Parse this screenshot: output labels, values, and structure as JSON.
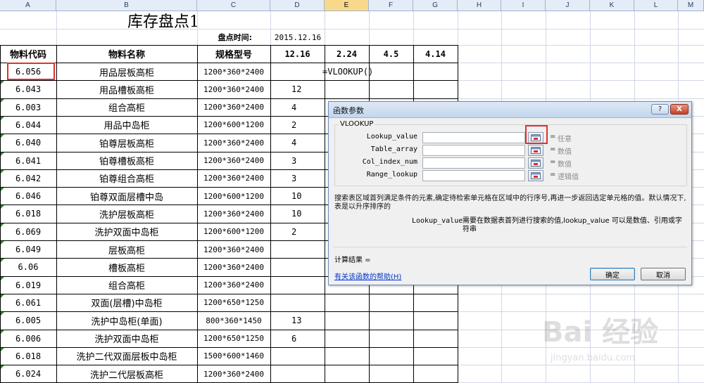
{
  "columns": [
    "A",
    "B",
    "C",
    "D",
    "E",
    "F",
    "G",
    "H",
    "I",
    "J",
    "K",
    "L",
    "M"
  ],
  "sheet": {
    "title": "库存盘点1",
    "check_time_label": "盘点时间:",
    "check_time_value": "2015.12.16",
    "headers": {
      "code": "物料代码",
      "name": "物料名称",
      "spec": "规格型号"
    },
    "dates": [
      "12.16",
      "2.24",
      "4.5",
      "4.14"
    ],
    "formula": "=VLOOKUP()",
    "rows": [
      {
        "code": "6.056",
        "name": "用品层板高柜",
        "spec": "1200*360*2400",
        "qty": ""
      },
      {
        "code": "6.043",
        "name": "用品槽板高柜",
        "spec": "1200*360*2400",
        "qty": "12"
      },
      {
        "code": "6.003",
        "name": "组合高柜",
        "spec": "1200*360*2400",
        "qty": "4"
      },
      {
        "code": "6.044",
        "name": "用品中岛柜",
        "spec": "1200*600*1200",
        "qty": "2"
      },
      {
        "code": "6.040",
        "name": "铂尊层板高柜",
        "spec": "1200*360*2400",
        "qty": "4"
      },
      {
        "code": "6.041",
        "name": "铂尊槽板高柜",
        "spec": "1200*360*2400",
        "qty": "3"
      },
      {
        "code": "6.042",
        "name": "铂尊组合高柜",
        "spec": "1200*360*2400",
        "qty": "3"
      },
      {
        "code": "6.046",
        "name": "铂尊双面层槽中岛",
        "spec": "1200*600*1200",
        "qty": "10"
      },
      {
        "code": "6.018",
        "name": "洗护层板高柜",
        "spec": "1200*360*2400",
        "qty": "10"
      },
      {
        "code": "6.069",
        "name": "洗护双面中岛柜",
        "spec": "1200*600*1200",
        "qty": "2"
      },
      {
        "code": "6.049",
        "name": "层板高柜",
        "spec": "1200*360*2400",
        "qty": ""
      },
      {
        "code": "6.06",
        "name": "槽板高柜",
        "spec": "1200*360*2400",
        "qty": ""
      },
      {
        "code": "6.019",
        "name": "组合高柜",
        "spec": "1200*360*2400",
        "qty": ""
      },
      {
        "code": "6.061",
        "name": "双面(层槽)中岛柜",
        "spec": "1200*650*1250",
        "qty": ""
      },
      {
        "code": "6.005",
        "name": "洗护中岛柜(单面)",
        "spec": "800*360*1450",
        "qty": "13"
      },
      {
        "code": "6.006",
        "name": "洗护双面中岛柜",
        "spec": "1200*650*1250",
        "qty": "6"
      },
      {
        "code": "6.018",
        "name": "洗护二代双面层板中岛柜",
        "spec": "1500*600*1460",
        "qty": ""
      },
      {
        "code": "6.024",
        "name": "洗护二代层板高柜",
        "spec": "1200*360*2400",
        "qty": ""
      }
    ]
  },
  "dialog": {
    "title": "函数参数",
    "help_btn": "?",
    "close_btn": "X",
    "function_name": "VLOOKUP",
    "args": [
      {
        "label": "Lookup_value",
        "hint": "任意"
      },
      {
        "label": "Table_array",
        "hint": "数值"
      },
      {
        "label": "Col_index_num",
        "hint": "数值"
      },
      {
        "label": "Range_lookup",
        "hint": "逻辑值"
      }
    ],
    "eq": "=",
    "description": "搜索表区域首列满足条件的元素,确定待检索单元格在区域中的行序号,再进一步返回选定单元格的值。默认情况下,表是以升序排序的",
    "arg_detail_label": "Lookup_value",
    "arg_detail_text": "需要在数据表首列进行搜索的值,lookup_value 可以是数值、引用或字符串",
    "result_label": "计算结果 =",
    "help_link": "有关该函数的帮助(H)",
    "ok": "确定",
    "cancel": "取消"
  },
  "watermark": {
    "text": "Bai 经验",
    "url": "jingyan.baidu.com"
  }
}
